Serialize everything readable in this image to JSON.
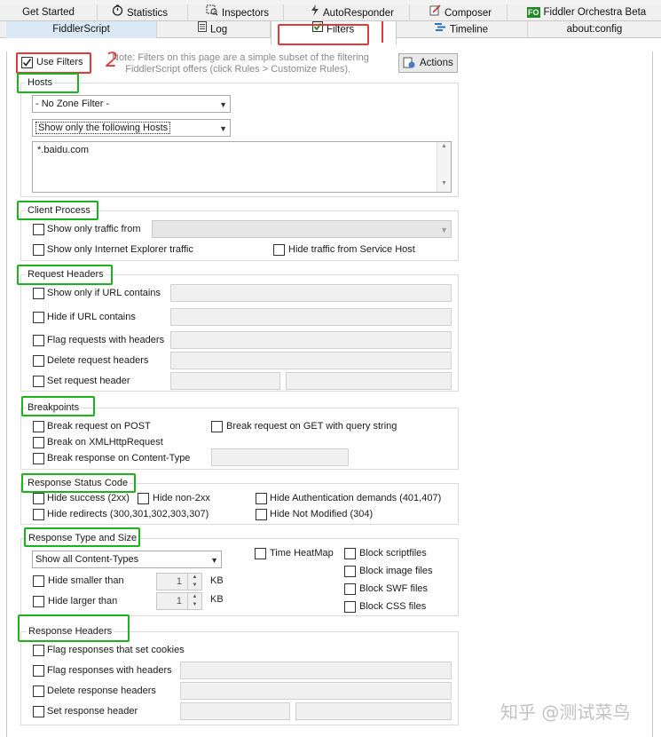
{
  "tabs_row1": [
    {
      "label": "Get Started",
      "icon": "none"
    },
    {
      "label": "Statistics",
      "icon": "stopwatch-icon"
    },
    {
      "label": "Inspectors",
      "icon": "inspectors-icon"
    },
    {
      "label": "AutoResponder",
      "icon": "lightning-icon"
    },
    {
      "label": "Composer",
      "icon": "composer-icon"
    },
    {
      "label": "Fiddler Orchestra Beta",
      "icon": "fo-badge-icon",
      "badge": "FO"
    }
  ],
  "tabs_row2": [
    {
      "label": "FiddlerScript",
      "icon": "none"
    },
    {
      "label": "Log",
      "icon": "log-icon"
    },
    {
      "label": "Filters",
      "icon": "checkbox-icon"
    },
    {
      "label": "Timeline",
      "icon": "timeline-icon"
    },
    {
      "label": "about:config",
      "icon": "none"
    }
  ],
  "top": {
    "use_filters": "Use Filters",
    "note": "Note: Filters on this page are a simple subset of the filtering FiddlerScript offers (click Rules > Customize Rules).",
    "note_line1": "Note: Filters on this page are a simple subset of the filtering",
    "note_line2": "FiddlerScript offers (click Rules > Customize Rules).",
    "actions": "Actions",
    "annotation": "2"
  },
  "hosts": {
    "title": "Hosts",
    "zone_filter": "- No Zone Filter -",
    "host_filter": "Show only the following Hosts",
    "hosts_text": "*.baidu.com"
  },
  "client_process": {
    "title": "Client Process",
    "show_only_from": "Show only traffic from",
    "ie_only": "Show only Internet Explorer traffic",
    "hide_service_host": "Hide traffic from Service Host"
  },
  "request_headers": {
    "title": "Request Headers",
    "url_contains": "Show only if URL contains",
    "hide_url": "Hide if URL contains",
    "flag_requests": "Flag requests with headers",
    "delete_headers": "Delete request headers",
    "set_header": "Set request header"
  },
  "breakpoints": {
    "title": "Breakpoints",
    "break_post": "Break request on POST",
    "break_get": "Break request on GET with query string",
    "break_xhr": "Break on XMLHttpRequest",
    "break_content_type": "Break response on Content-Type"
  },
  "response_status": {
    "title": "Response Status Code",
    "hide_success": "Hide success (2xx)",
    "hide_non2xx": "Hide non-2xx",
    "hide_auth": "Hide Authentication demands (401,407)",
    "hide_redirects": "Hide redirects (300,301,302,303,307)",
    "hide_not_modified": "Hide Not Modified (304)"
  },
  "response_type": {
    "title": "Response Type and Size",
    "content_types": "Show all Content-Types",
    "time_heatmap": "Time HeatMap",
    "hide_smaller": "Hide smaller than",
    "hide_larger": "Hide larger than",
    "smaller_value": "1",
    "larger_value": "1",
    "unit": "KB",
    "block_script": "Block scriptfiles",
    "block_image": "Block image files",
    "block_swf": "Block SWF files",
    "block_css": "Block CSS files"
  },
  "response_headers": {
    "title": "Response Headers",
    "flag_cookies": "Flag responses that set cookies",
    "flag_headers": "Flag responses with headers",
    "delete_headers": "Delete response headers",
    "set_header": "Set response header"
  },
  "watermark": "知乎 @测试菜鸟",
  "colors": {
    "green_highlight": "#1db31d",
    "red_highlight": "#e23a3a",
    "tab_bg": "#f0f0f0"
  }
}
